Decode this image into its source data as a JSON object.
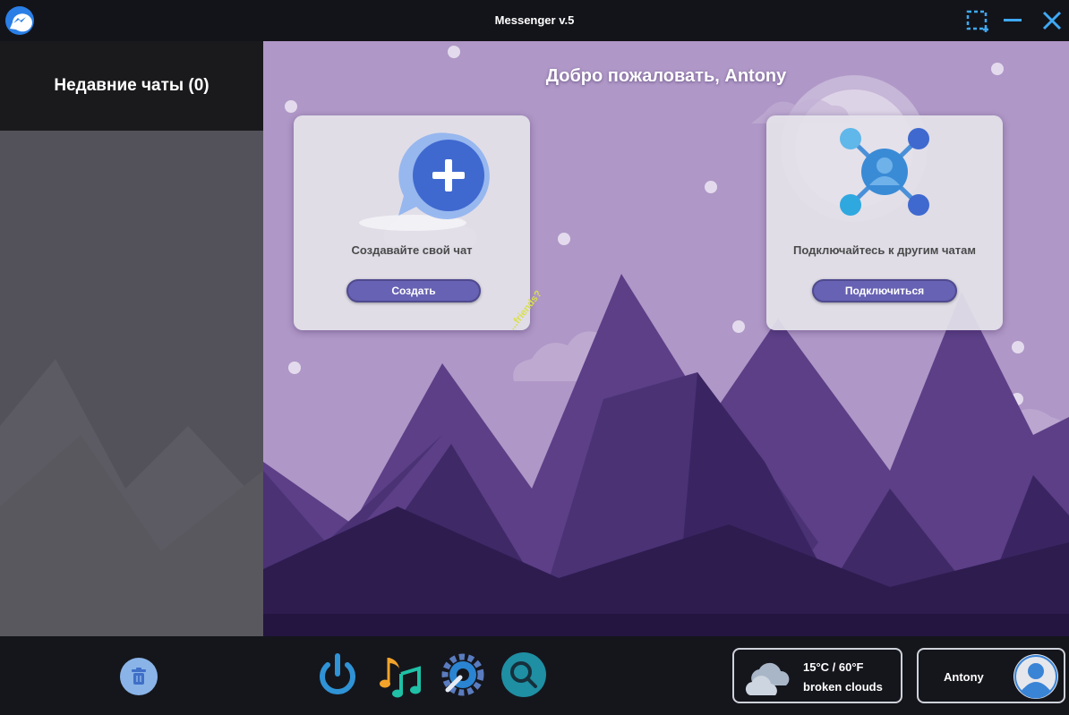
{
  "window": {
    "title": "Messenger v.5",
    "controls": [
      "snip-icon",
      "minimize-icon",
      "close-icon"
    ]
  },
  "sidebar": {
    "header": "Недавние чаты (0)"
  },
  "main": {
    "welcome": "Добро пожаловать, Antony",
    "friends_tag": "...friends?",
    "cards": [
      {
        "label": "Создавайте свой чат",
        "button": "Создать",
        "icon": "chat-plus-icon"
      },
      {
        "label": "Подключайтесь к другим чатам",
        "button": "Подключиться",
        "icon": "network-user-icon"
      }
    ]
  },
  "dock": {
    "icons": [
      "power-icon",
      "music-icon",
      "settings-icon",
      "search-icon"
    ]
  },
  "weather": {
    "temperature": "15°C / 60°F",
    "condition": "broken clouds",
    "icon": "cloud-icon"
  },
  "user": {
    "name": "Antony"
  },
  "colors": {
    "titlebar": "#13141a",
    "accent": "#6762b3",
    "sky": "#af97c7",
    "sidebar": "#53525a"
  }
}
